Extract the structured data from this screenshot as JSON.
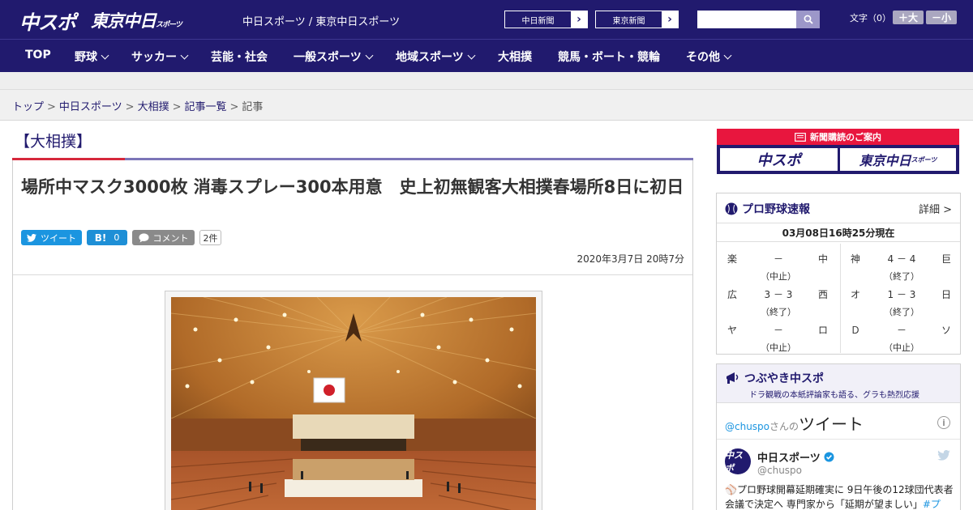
{
  "header": {
    "logo_chuspo": "中スポ",
    "logo_tokyo": "東京中日",
    "logo_tokyo_small": "スポーツ",
    "site_links": "中日スポーツ / 東京中日スポーツ",
    "paper_buttons": [
      "中日新聞",
      "東京新聞"
    ],
    "search_placeholder": "",
    "font_size_label": "文字（0）",
    "font_larger": "＋大",
    "font_smaller": "－小"
  },
  "nav": {
    "items": [
      "TOP",
      "野球",
      "サッカー",
      "芸能・社会",
      "一般スポーツ",
      "地域スポーツ",
      "大相撲",
      "競馬・ボート・競輪",
      "その他"
    ]
  },
  "breadcrumb": {
    "items": [
      "トップ",
      "中日スポーツ",
      "大相撲",
      "記事一覧"
    ],
    "current": "記事",
    "separator": ">"
  },
  "article": {
    "category": "【大相撲】",
    "headline": "場所中マスク3000枚 消毒スプレー300本用意　史上初無観客大相撲春場所8日に初日",
    "tweet_label": "ツイート",
    "hatena_label": "B!",
    "hatena_count": "0",
    "comment_label": "コメント",
    "comment_count": "2件",
    "date": "2020年3月7日 20時7分"
  },
  "sidebar": {
    "subscription_header": "新聞購読のご案内",
    "sub_logo_chuspo": "中スポ",
    "sub_logo_tokyo": "東京中日",
    "sub_logo_tokyo_small": "スポーツ",
    "score_title": "プロ野球速報",
    "score_detail": "詳細 >",
    "score_time": "03月08日16時25分現在",
    "games": [
      {
        "home": "楽",
        "score": "－",
        "away": "中",
        "status": "（中止）"
      },
      {
        "home": "神",
        "score": "4 － 4",
        "away": "巨",
        "status": "（終了）"
      },
      {
        "home": "広",
        "score": "3 － 3",
        "away": "西",
        "status": "（終了）"
      },
      {
        "home": "オ",
        "score": "1 － 3",
        "away": "日",
        "status": "（終了）"
      },
      {
        "home": "ヤ",
        "score": "－",
        "away": "ロ",
        "status": "（中止）"
      },
      {
        "home": "Ｄ",
        "score": "－",
        "away": "ソ",
        "status": "（中止）"
      }
    ],
    "tweet_widget_title": "つぶやき中スポ",
    "tweet_widget_sub": "ドラ観戦の本紙評論家も語る、グラも熱烈応援",
    "tweet_handle_link": "@chuspo",
    "tweet_handle_suffix": "さんの",
    "tweet_heading": "ツイート",
    "tweet_account_name": "中日スポーツ",
    "tweet_account_handle": "@chuspo",
    "tweet_avatar_text": "中スポ",
    "tweet_text": "プロ野球開幕延期確実に 9日午後の12球団代表者会議で決定へ 専門家から「延期が望ましい」",
    "tweet_hashtag": "#プ"
  },
  "colors": {
    "brand_navy": "#211a6e",
    "accent_red": "#d6283c",
    "twitter_blue": "#1b95e0",
    "hatena_blue": "#1e8fd6",
    "comment_grey": "#8a8a8a"
  }
}
